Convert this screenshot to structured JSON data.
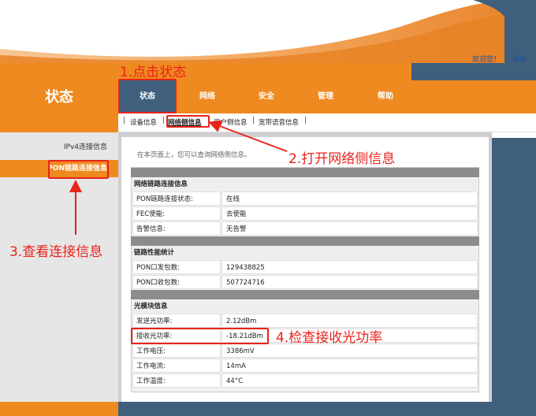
{
  "header": {
    "welcome_link": "欢迎您！",
    "logout_link": "退出",
    "page_title": "状态"
  },
  "nav": {
    "tabs": [
      {
        "label": "状态",
        "active": true
      },
      {
        "label": "网络",
        "active": false
      },
      {
        "label": "安全",
        "active": false
      },
      {
        "label": "管理",
        "active": false
      },
      {
        "label": "帮助",
        "active": false
      }
    ],
    "separator": "|",
    "subtabs": [
      {
        "label": "设备信息",
        "active": false
      },
      {
        "label": "网络侧信息",
        "active": true
      },
      {
        "label": "用户侧信息",
        "active": false
      },
      {
        "label": "宽带语音信息",
        "active": false
      }
    ]
  },
  "sidebar": {
    "items": [
      {
        "label": "IPv4连接信息",
        "active": false
      },
      {
        "label": "PON链路连接信息",
        "active": true
      }
    ]
  },
  "main": {
    "intro": "在本页面上，您可以查询网络侧信息。",
    "sections": [
      {
        "title": "网络链路连接信息",
        "rows": [
          {
            "label": "PON链路连接状态:",
            "value": "在线"
          },
          {
            "label": "FEC使能:",
            "value": "去使能"
          },
          {
            "label": "告警信息:",
            "value": "无告警"
          }
        ]
      },
      {
        "title": "链路性能统计",
        "rows": [
          {
            "label": "PON口发包数:",
            "value": "129438825"
          },
          {
            "label": "PON口收包数:",
            "value": "507724716"
          }
        ]
      },
      {
        "title": "光模块信息",
        "rows": [
          {
            "label": "发送光功率:",
            "value": "2.12dBm"
          },
          {
            "label": "接收光功率:",
            "value": "-18.21dBm"
          },
          {
            "label": "工作电压:",
            "value": "3386mV"
          },
          {
            "label": "工作电流:",
            "value": "14mA"
          },
          {
            "label": "工作温度:",
            "value": "44°C"
          }
        ]
      }
    ]
  },
  "annotations": {
    "step1": "1.点击状态",
    "step2": "2.打开网络侧信息",
    "step3": "3.查看连接信息",
    "step4": "4.检查接收光功率"
  },
  "colors": {
    "orange": "#ef8a20",
    "steel_blue": "#3f5f7c",
    "annotation_red": "#e8231a"
  }
}
